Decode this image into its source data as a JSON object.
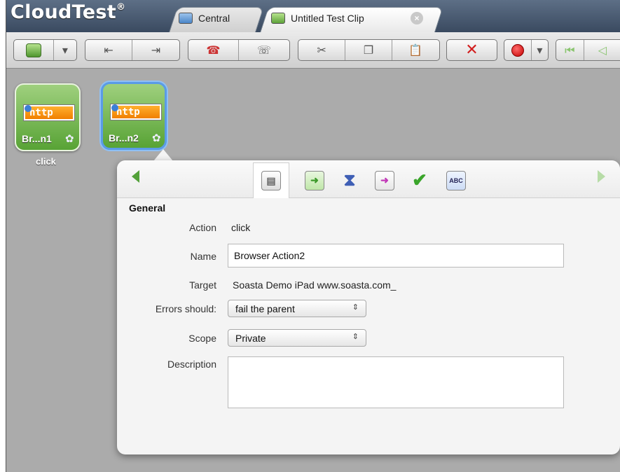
{
  "app": {
    "brand": "CloudTest",
    "brand_mark": "®"
  },
  "tabs": [
    {
      "label": "Central",
      "icon": "central-icon"
    },
    {
      "label": "Untitled Test Clip",
      "icon": "test-clip-icon",
      "active": true
    }
  ],
  "canvas": {
    "actions": [
      {
        "badge": "http",
        "label": "Br...n1",
        "below": "click",
        "selected": false
      },
      {
        "badge": "http",
        "label": "Br...n2",
        "below": "",
        "selected": true
      }
    ]
  },
  "panel": {
    "section": "General",
    "action_label": "Action",
    "action_value": "click",
    "name_label": "Name",
    "name_value": "Browser Action2",
    "target_label": "Target",
    "target_value": "Soasta Demo iPad www.soasta.com_",
    "errors_label": "Errors should:",
    "errors_value": "fail the parent",
    "scope_label": "Scope",
    "scope_value": "Private",
    "description_label": "Description",
    "description_value": "",
    "tab_icons": [
      "general-properties-icon",
      "input-icon",
      "waits-icon",
      "output-icon",
      "validation-icon",
      "abc-properties-icon"
    ],
    "tab_abc": "ABC"
  },
  "colors": {
    "accent_green": "#58a335",
    "selection_blue": "#5a9be6",
    "badge_orange": "#f07f00"
  }
}
